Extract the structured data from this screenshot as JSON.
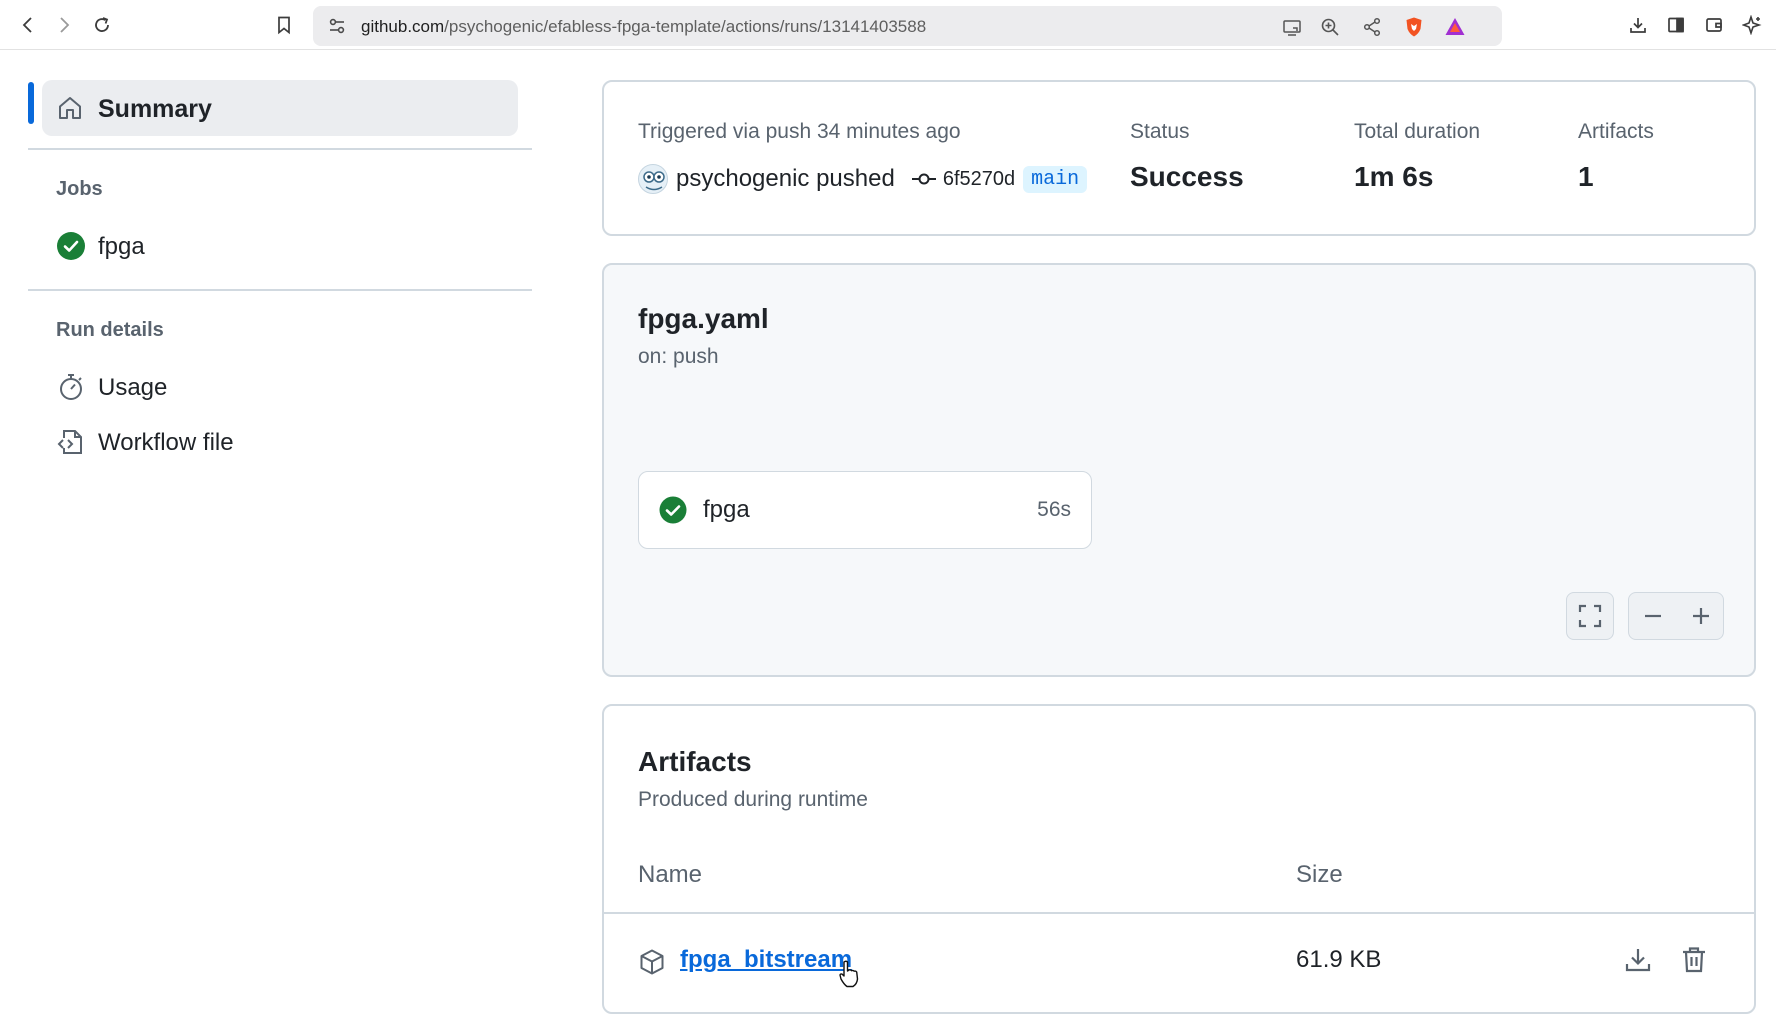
{
  "browser": {
    "url_host": "github.com",
    "url_path": "/psychogenic/efabless-fpga-template/actions/runs/13141403588"
  },
  "sidebar": {
    "summary_label": "Summary",
    "jobs_heading": "Jobs",
    "jobs": [
      {
        "label": "fpga",
        "status": "success"
      }
    ],
    "run_details_heading": "Run details",
    "run_details": [
      {
        "label": "Usage",
        "icon": "stopwatch-icon"
      },
      {
        "label": "Workflow file",
        "icon": "file-code-icon"
      }
    ]
  },
  "summary": {
    "trigger_text": "Triggered via push 34 minutes ago",
    "actor": "psychogenic pushed",
    "commit_sha": "6f5270d",
    "branch": "main",
    "status_label": "Status",
    "status_value": "Success",
    "duration_label": "Total duration",
    "duration_value": "1m 6s",
    "artifacts_label": "Artifacts",
    "artifacts_value": "1"
  },
  "workflow": {
    "file": "fpga.yaml",
    "trigger": "on: push",
    "job_name": "fpga",
    "job_duration": "56s"
  },
  "artifacts": {
    "title": "Artifacts",
    "subtitle": "Produced during runtime",
    "col_name": "Name",
    "col_size": "Size",
    "items": [
      {
        "name": "fpga_bitstream",
        "size": "61.9 KB"
      }
    ]
  },
  "colors": {
    "accent": "#0969da",
    "success": "#1a7f37",
    "muted": "#59636e",
    "border": "#d1d9e0"
  }
}
